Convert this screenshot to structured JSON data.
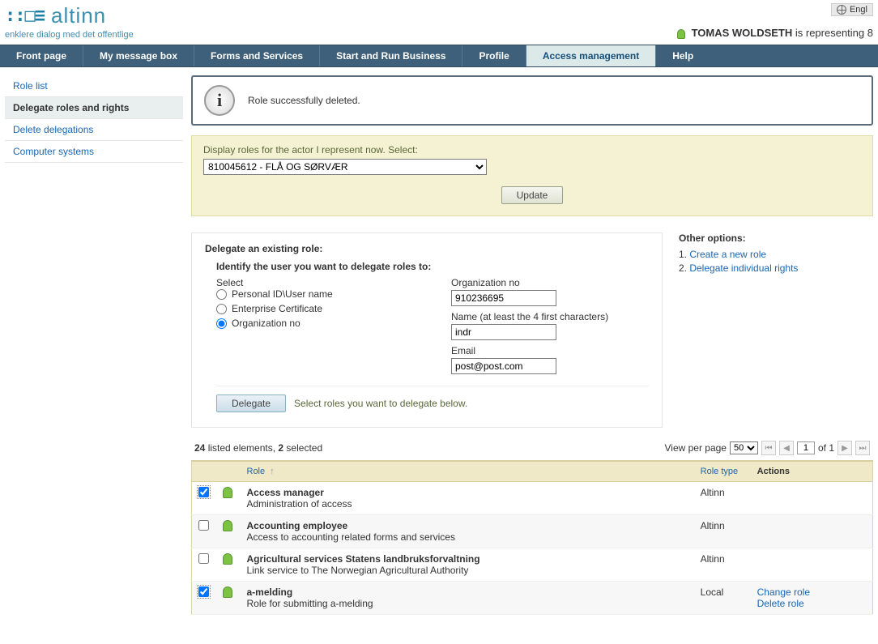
{
  "header": {
    "brand": "altinn",
    "tagline": "enklere dialog med det offentlige",
    "lang_label": "Engl",
    "user_name": "TOMAS WOLDSETH",
    "user_suffix": " is representing 8"
  },
  "nav": {
    "items": [
      "Front page",
      "My message box",
      "Forms and Services",
      "Start and Run Business",
      "Profile",
      "Access management",
      "Help"
    ],
    "active_index": 5
  },
  "sidebar": {
    "items": [
      "Role list",
      "Delegate roles and rights",
      "Delete delegations",
      "Computer systems"
    ],
    "active_index": 1
  },
  "alert": {
    "text": "Role successfully deleted."
  },
  "actor_panel": {
    "label": "Display roles for the actor I represent now. Select:",
    "selected": "810045612 - FLÅ OG SØRVÆR",
    "update_btn": "Update"
  },
  "delegate": {
    "title": "Delegate an existing role:",
    "identify": "Identify the user you want to delegate roles to:",
    "select_label": "Select",
    "radios": [
      "Personal ID\\User name",
      "Enterprise Certificate",
      "Organization no"
    ],
    "radio_selected": 2,
    "org_label": "Organization no",
    "org_value": "910236695",
    "name_label": "Name (at least the 4 first characters)",
    "name_value": "indr",
    "email_label": "Email",
    "email_value": "post@post.com",
    "delegate_btn": "Delegate",
    "hint": "Select roles you want to delegate below."
  },
  "options": {
    "title": "Other options:",
    "link1_prefix": "1. ",
    "link1": "Create a new role",
    "link2_prefix": "2. ",
    "link2": "Delegate individual rights"
  },
  "list": {
    "count_bold1": "24",
    "count_text1": " listed elements, ",
    "count_bold2": "2",
    "count_text2": " selected",
    "view_label": "View per page",
    "per_page": "50",
    "page": "1",
    "of_label": " of 1 ",
    "col_role": "Role",
    "col_type": "Role type",
    "col_actions": "Actions",
    "rows": [
      {
        "checked": true,
        "name": "Access manager",
        "desc": "Administration of access",
        "type": "Altinn",
        "actions": []
      },
      {
        "checked": false,
        "name": "Accounting employee",
        "desc": "Access to accounting related forms and services",
        "type": "Altinn",
        "actions": []
      },
      {
        "checked": false,
        "name": "Agricultural services Statens landbruksforvaltning",
        "desc": "Link service to The Norwegian Agricultural Authority",
        "type": "Altinn",
        "actions": []
      },
      {
        "checked": true,
        "name": "a-melding",
        "desc": "Role for submitting a-melding",
        "type": "Local",
        "actions": [
          "Change role",
          "Delete role"
        ]
      }
    ]
  }
}
